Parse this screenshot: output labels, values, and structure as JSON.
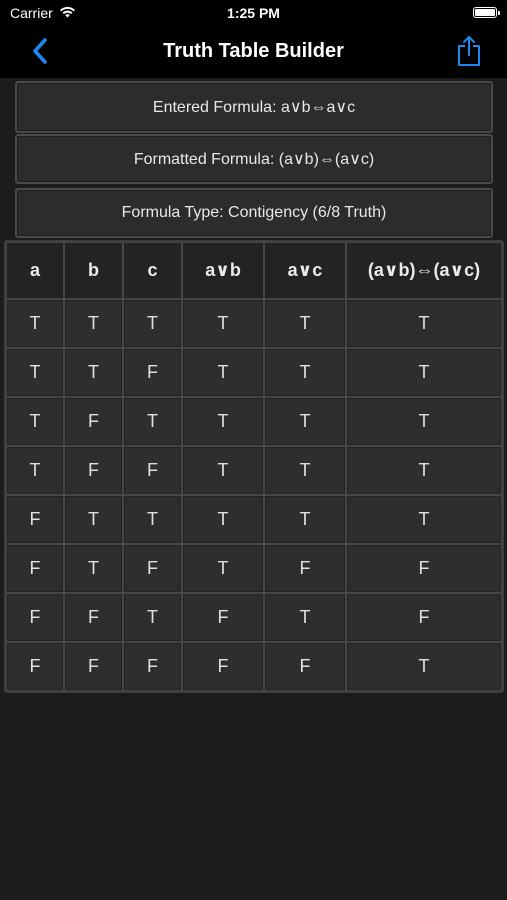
{
  "status_bar": {
    "carrier": "Carrier",
    "time": "1:25 PM",
    "icons": [
      "wifi-icon",
      "battery-icon"
    ]
  },
  "nav": {
    "title": "Truth Table Builder",
    "back_icon": "chevron-left-icon",
    "share_icon": "share-icon",
    "accent_color": "#1e87f0"
  },
  "info": {
    "entered": "Entered Formula: a∨b⇔a∨c",
    "formatted": "Formatted Formula: (a∨b)⇔(a∨c)",
    "type": "Formula Type: Contigency (6/8 Truth)"
  },
  "table": {
    "headers": [
      "a",
      "b",
      "c",
      "a∨b",
      "a∨c",
      "(a∨b)⇔(a∨c)"
    ],
    "rows": [
      [
        "T",
        "T",
        "T",
        "T",
        "T",
        "T"
      ],
      [
        "T",
        "T",
        "F",
        "T",
        "T",
        "T"
      ],
      [
        "T",
        "F",
        "T",
        "T",
        "T",
        "T"
      ],
      [
        "T",
        "F",
        "F",
        "T",
        "T",
        "T"
      ],
      [
        "F",
        "T",
        "T",
        "T",
        "T",
        "T"
      ],
      [
        "F",
        "T",
        "F",
        "T",
        "F",
        "F"
      ],
      [
        "F",
        "F",
        "T",
        "F",
        "T",
        "F"
      ],
      [
        "F",
        "F",
        "F",
        "F",
        "F",
        "T"
      ]
    ]
  }
}
